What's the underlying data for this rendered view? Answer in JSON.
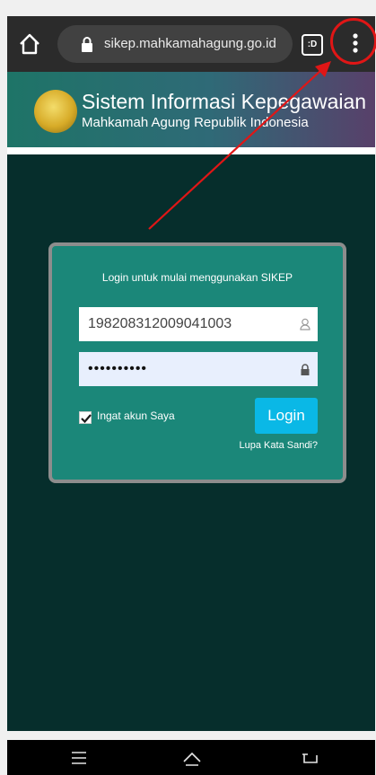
{
  "browser": {
    "url": "sikep.mahkamahagung.go.id",
    "tab_label": ":D"
  },
  "site": {
    "title": "Sistem Informasi Kepegawaian",
    "subtitle": "Mahkamah Agung Republik Indonesia"
  },
  "login": {
    "prompt": "Login untuk mulai menggunakan SIKEP",
    "nip_value": "198208312009041003",
    "password_value": "••••••••••",
    "remember_label": "Ingat akun Saya",
    "remember_checked": true,
    "login_label": "Login",
    "forgot_label": "Lupa Kata Sandi?"
  },
  "colors": {
    "annotation": "#e01616",
    "login_button": "#0ab8e6",
    "card": "#1b8779",
    "page_bg": "#062e2c"
  },
  "icons": [
    "home-icon",
    "lock-icon",
    "tab-switcher-icon",
    "more-vert-icon",
    "user-icon",
    "padlock-icon",
    "checkbox-icon",
    "nav-menu-icon",
    "nav-home-icon",
    "nav-back-icon"
  ]
}
